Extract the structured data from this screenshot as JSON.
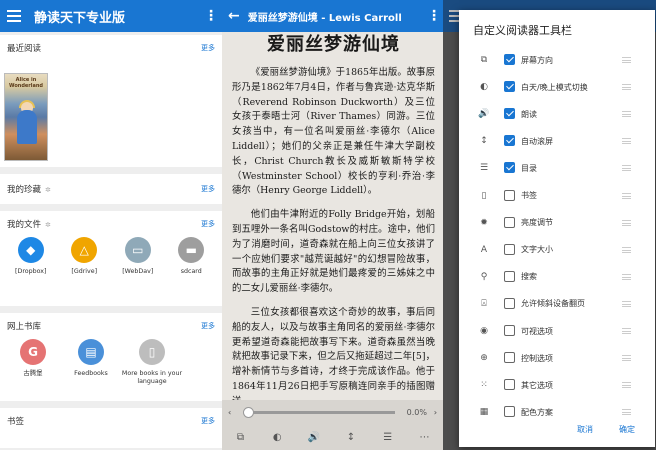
{
  "library": {
    "app_title": "静读天下专业版",
    "recent": {
      "title": "最近阅读",
      "more": "更多",
      "cover_title": "Alice in Wonderland"
    },
    "favorites": {
      "title": "我的珍藏",
      "more": "更多"
    },
    "files": {
      "title": "我的文件",
      "more": "更多",
      "items": [
        {
          "label": "[Dropbox]",
          "icon": "dropbox-icon",
          "color": "#1e88e5"
        },
        {
          "label": "[Gdrive]",
          "icon": "google-drive-icon",
          "color": "#f0a500"
        },
        {
          "label": "[WebDav]",
          "icon": "webdav-icon",
          "color": "#8fa9b8"
        },
        {
          "label": "sdcard",
          "icon": "folder-icon",
          "color": "#9e9e9e"
        }
      ]
    },
    "online": {
      "title": "网上书库",
      "more": "更多",
      "items": [
        {
          "label": "古腾堡",
          "icon": "gutenberg-icon",
          "color": "#e57373"
        },
        {
          "label": "Feedbooks",
          "icon": "feedbooks-icon",
          "color": "#4a90d9"
        },
        {
          "label": "More books in your language",
          "icon": "book-icon",
          "color": "#bdbdbd"
        }
      ]
    },
    "bookmarks": {
      "title": "书签",
      "more": "更多"
    }
  },
  "reader": {
    "title": "爱丽丝梦游仙境 - Lewis Carroll",
    "heading": "爱丽丝梦游仙境",
    "paragraphs": [
      "《爱丽丝梦游仙境》于1865年出版。故事原形乃是1862年7月4日，作者与鲁宾逊·达克华斯（Reverend Robinson Duckworth）及三位女孩于泰晤士河（River Thames）同游。三位女孩当中，有一位名叫爱丽丝·李德尔（Alice Liddell）；她们的父亲正是兼任牛津大学副校长，Christ Church教长及威斯敏斯特学校（Westminster School）校长的亨利·乔治·李德尔（Henry George Liddell）。",
      "他们由牛津附近的Folly Bridge开始，划船到五哩外一条名叫Godstow的村庄。途中，他们为了消磨时间，道奇森就在船上向三位女孩讲了一个应她们要求\"越荒诞越好\"的幻想冒险故事，而故事的主角正好就是她们最疼爱的三姊妹之中的二女儿爱丽丝·李德尔。",
      "三位女孩都很喜欢这个奇妙的故事，事后同船的友人，以及与故事主角同名的爱丽丝·李德尔更希望道奇森能把故事写下来。道奇森虽然当晚就把故事记录下来，但之后又拖延超过二年[5]，增补新情节与多首诗，才终于完成该作品。他于1864年11月26日把手写原稿连同亲手的插图赠送……"
    ],
    "progress_percent": "0.0%",
    "progress_value": 0.0
  },
  "dialog": {
    "title": "自定义阅读器工具栏",
    "items": [
      {
        "label": "屏幕方向",
        "icon": "screen-rotation-icon",
        "glyph": "⧉",
        "checked": true
      },
      {
        "label": "白天/晚上模式切换",
        "icon": "day-night-icon",
        "glyph": "◐",
        "checked": true
      },
      {
        "label": "朗读",
        "icon": "speaker-icon",
        "glyph": "🔊",
        "checked": true
      },
      {
        "label": "自动滚屏",
        "icon": "auto-scroll-icon",
        "glyph": "↕",
        "checked": true
      },
      {
        "label": "目录",
        "icon": "toc-icon",
        "glyph": "☰",
        "checked": true
      },
      {
        "label": "书签",
        "icon": "bookmark-icon",
        "glyph": "▯",
        "checked": false
      },
      {
        "label": "亮度调节",
        "icon": "brightness-icon",
        "glyph": "✹",
        "checked": false
      },
      {
        "label": "文字大小",
        "icon": "font-size-icon",
        "glyph": "A",
        "checked": false
      },
      {
        "label": "搜索",
        "icon": "search-icon",
        "glyph": "⚲",
        "checked": false
      },
      {
        "label": "允许倾斜设备翻页",
        "icon": "tilt-icon",
        "glyph": "⍓",
        "checked": false
      },
      {
        "label": "可视选项",
        "icon": "eye-icon",
        "glyph": "◉",
        "checked": false
      },
      {
        "label": "控制选项",
        "icon": "control-icon",
        "glyph": "⊕",
        "checked": false
      },
      {
        "label": "其它选项",
        "icon": "other-options-icon",
        "glyph": "⁙",
        "checked": false
      },
      {
        "label": "配色方案",
        "icon": "color-scheme-icon",
        "glyph": "▦",
        "checked": false
      }
    ],
    "cancel": "取消",
    "ok": "确定"
  },
  "toolbar_icons": [
    "screen-rotation-icon",
    "day-night-icon",
    "speaker-icon",
    "auto-scroll-icon",
    "toc-icon",
    "more-icon"
  ],
  "colors": {
    "primary": "#1976d2",
    "dialog_overlay": "#4d4d4d"
  }
}
